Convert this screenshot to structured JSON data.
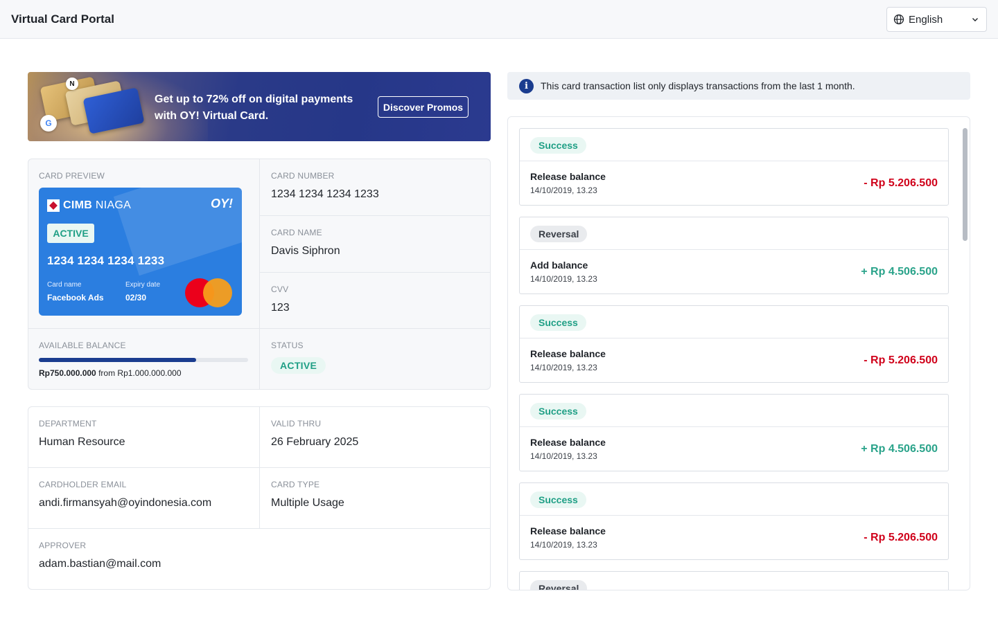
{
  "header": {
    "title": "Virtual Card Portal",
    "language": "English"
  },
  "promo": {
    "text_line1": "Get up to 72% off on digital payments",
    "text_line2": "with OY! Virtual Card.",
    "button": "Discover Promos"
  },
  "card": {
    "preview_label": "CARD PREVIEW",
    "bank_name_bold": "CIMB",
    "bank_name_light": "NIAGA",
    "brand": "OY!",
    "active_badge": "ACTIVE",
    "number": "1234 1234 1234 1233",
    "card_name_label": "Card name",
    "card_name_value": "Facebook Ads",
    "expiry_label": "Expiry date",
    "expiry_value": "02/30"
  },
  "details": {
    "card_number_label": "CARD NUMBER",
    "card_number": "1234 1234 1234 1233",
    "card_name_label": "CARD NAME",
    "card_name": "Davis Siphron",
    "cvv_label": "CVV",
    "cvv": "123",
    "balance_label": "AVAILABLE BALANCE",
    "balance_available": "Rp750.000.000",
    "balance_from": "from Rp1.000.000.000",
    "balance_fraction": 0.75,
    "status_label": "STATUS",
    "status": "ACTIVE"
  },
  "info": {
    "department_label": "DEPARTMENT",
    "department": "Human Resource",
    "valid_thru_label": "VALID THRU",
    "valid_thru": "26 February 2025",
    "email_label": "CARDHOLDER EMAIL",
    "email": "andi.firmansyah@oyindonesia.com",
    "card_type_label": "CARD TYPE",
    "card_type": "Multiple Usage",
    "approver_label": "APPROVER",
    "approver": "adam.bastian@mail.com"
  },
  "notice": "This card transaction list only displays transactions from the last 1 month.",
  "transactions": [
    {
      "status": "Success",
      "title": "Release balance",
      "date": "14/10/2019, 13.23",
      "amount": "- Rp 5.206.500",
      "sign": "neg"
    },
    {
      "status": "Reversal",
      "title": "Add balance",
      "date": "14/10/2019, 13.23",
      "amount": "+ Rp 4.506.500",
      "sign": "pos"
    },
    {
      "status": "Success",
      "title": "Release balance",
      "date": "14/10/2019, 13.23",
      "amount": "- Rp 5.206.500",
      "sign": "neg"
    },
    {
      "status": "Success",
      "title": "Release balance",
      "date": "14/10/2019, 13.23",
      "amount": "+ Rp 4.506.500",
      "sign": "pos"
    },
    {
      "status": "Success",
      "title": "Release balance",
      "date": "14/10/2019, 13.23",
      "amount": "- Rp 5.206.500",
      "sign": "neg"
    },
    {
      "status": "Reversal",
      "title": "",
      "date": "",
      "amount": "",
      "sign": "pos"
    }
  ],
  "colors": {
    "success": "#1f9f85",
    "negative": "#d0021b",
    "positive": "#2aa38a",
    "primary": "#1b3d8f",
    "card": "#2b7ee0"
  }
}
